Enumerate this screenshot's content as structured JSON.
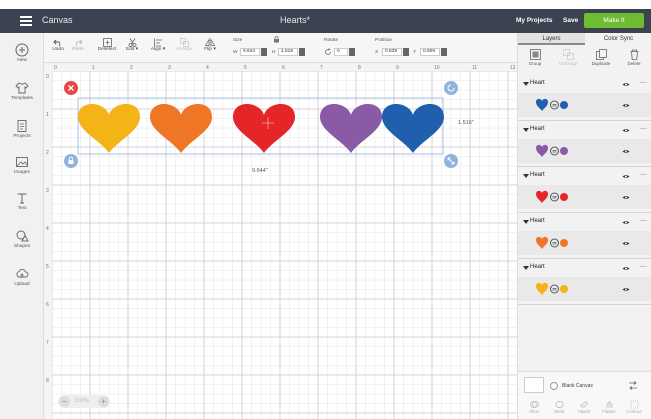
{
  "header": {
    "app_title": "Canvas",
    "doc_title": "Hearts*",
    "my_projects": "My Projects",
    "save": "Save",
    "make_it": "Make It"
  },
  "left_tools": [
    {
      "label": "New",
      "icon": "plus-icon"
    },
    {
      "label": "Templates",
      "icon": "shirt-icon"
    },
    {
      "label": "Projects",
      "icon": "projects-icon"
    },
    {
      "label": "Images",
      "icon": "image-icon"
    },
    {
      "label": "Text",
      "icon": "text-icon"
    },
    {
      "label": "Shapes",
      "icon": "shapes-icon"
    },
    {
      "label": "Upload",
      "icon": "upload-icon"
    }
  ],
  "toolbar": {
    "undo": "Undo",
    "redo": "Redo",
    "deselect": "Deselect",
    "edit": "Edit",
    "align": "Align",
    "arrange": "Arrange",
    "flip": "Flip",
    "size_label": "Size",
    "w_label": "W",
    "w_value": "9.644",
    "h_label": "H",
    "h_value": "1.516",
    "rotate_label": "Rotate",
    "rotate_value": "0",
    "position_label": "Position",
    "x_label": "X",
    "x_value": "0.639",
    "y_label": "Y",
    "y_value": "0.609"
  },
  "canvas": {
    "ruler_top": [
      "0",
      "1",
      "2",
      "3",
      "4",
      "5",
      "6",
      "7",
      "8",
      "9",
      "10",
      "11",
      "12"
    ],
    "ruler_left": [
      "0",
      "1",
      "2",
      "3",
      "4",
      "5",
      "6",
      "7",
      "8"
    ],
    "width_dim": "9.644\"",
    "height_dim": "1.516\"",
    "zoom": "100%",
    "hearts": [
      {
        "color": "#f4b317"
      },
      {
        "color": "#ef7624"
      },
      {
        "color": "#e52629"
      },
      {
        "color": "#8a5aa6"
      },
      {
        "color": "#1f5fae"
      }
    ],
    "selection_handles": {
      "delete": "#e8474a",
      "rotate": "#8fb3de",
      "lock": "#8fb3de",
      "scale": "#8fb3de"
    }
  },
  "right_panel": {
    "tabs": [
      "Layers",
      "Color Sync"
    ],
    "tools": [
      "Group",
      "UnGroup",
      "Duplicate",
      "Delete"
    ],
    "layers": [
      {
        "name": "Heart",
        "color": "#1f5fae"
      },
      {
        "name": "Heart",
        "color": "#8a5aa6"
      },
      {
        "name": "Heart",
        "color": "#e52629"
      },
      {
        "name": "Heart",
        "color": "#ef7624"
      },
      {
        "name": "Heart",
        "color": "#f4b317"
      }
    ],
    "blank_canvas": "Blank Canvas",
    "bottom_tools": [
      "Slice",
      "Weld",
      "Attach",
      "Flatten",
      "Contour"
    ]
  }
}
